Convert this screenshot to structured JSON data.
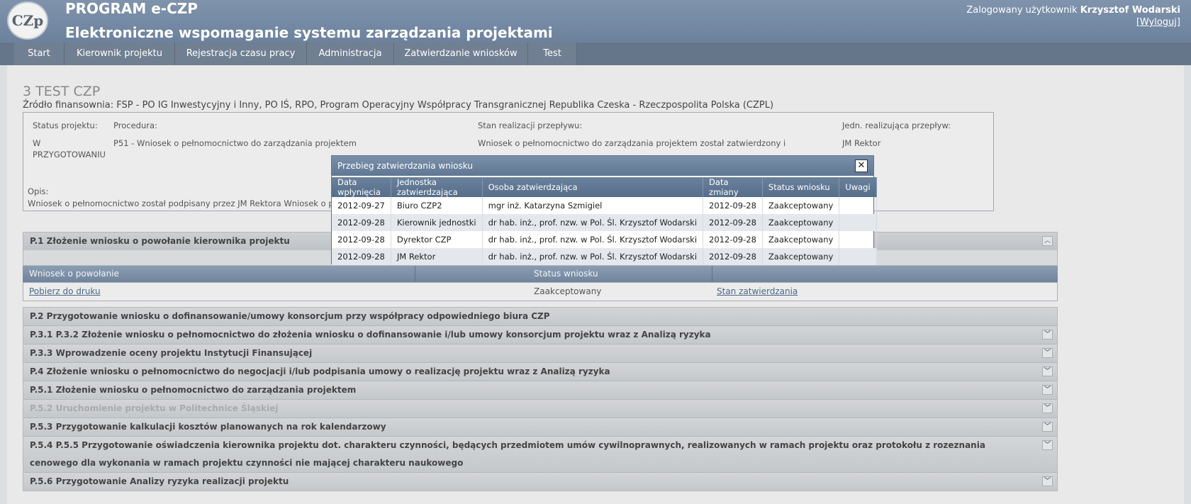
{
  "header": {
    "logo_text": "CZp",
    "app_title": "PROGRAM e-CZP",
    "app_subtitle": "Elektroniczne wspomaganie systemu zarządzania projektami",
    "user_label": "Zalogowany użytkownik",
    "user_name": "Krzysztof Wodarski",
    "logout_label": "Wyloguj"
  },
  "nav": {
    "items": [
      {
        "label": "Start"
      },
      {
        "label": "Kierownik projektu"
      },
      {
        "label": "Rejestracja czasu pracy"
      },
      {
        "label": "Administracja"
      },
      {
        "label": "Zatwierdzanie wniosków"
      },
      {
        "label": "Test"
      }
    ]
  },
  "project": {
    "title": "3 TEST CZP",
    "funding": "Źródło finansownia: FSP - PO IG Inwestycyjny i Inny, PO IŚ, RPO, Program Operacyjny Współpracy Transgranicznej Republika Czeska - Rzeczpospolita Polska (CZPL)",
    "status_label": "Status projektu:",
    "status_value": "W PRZYGOTOWANIU",
    "procedure_label": "Procedura:",
    "procedure_value": "P51 - Wniosek o pełnomocnictwo do zarządzania projektem",
    "flow_label": "Stan realizacji przepływu:",
    "flow_value": "Wniosek o pełnomocnictwo do zarządzania projektem został zatwierdzony i podpisany przez JM Rektora",
    "unit_label": "Jedn. realizująca przepływ:",
    "unit_value": "JM Rektor",
    "desc_label": "Opis:",
    "desc_value": "Wniosek o pełnomocnictwo został podpisany przez JM Rektora Wniosek o pełno"
  },
  "p1": {
    "header": "P.1 Złożenie wniosku o powołanie kierownika projektu",
    "col1": "Wniosek o powołanie",
    "col2": "Status wniosku",
    "row_link": "Pobierz do druku",
    "row_status": "Zaakceptowany",
    "row_action": "Stan zatwierdzania"
  },
  "accordion": [
    {
      "label": "P.2 Przygotowanie wniosku o dofinansowanie/umowy konsorcjum przy współpracy odpowiedniego biura CZP",
      "chevron": false,
      "disabled": false
    },
    {
      "label": "P.3.1 P.3.2 Złożenie wniosku o pełnomocnictwo do złożenia wniosku o dofinansowanie i/lub umowy konsorcjum projektu wraz z Analizą ryzyka",
      "chevron": true,
      "disabled": false
    },
    {
      "label": "P.3.3 Wprowadzenie oceny projektu Instytucji Finansującej",
      "chevron": true,
      "disabled": false
    },
    {
      "label": "P.4 Złożenie wniosku o pełnomocnictwo do negocjacji i/lub podpisania umowy o realizację projektu wraz z Analizą ryzyka",
      "chevron": true,
      "disabled": false
    },
    {
      "label": "P.5.1 Złożenie wniosku o pełnomocnictwo do zarządzania projektem",
      "chevron": true,
      "disabled": false
    },
    {
      "label": "P.5.2 Uruchomienie projektu w Politechnice Śląskiej",
      "chevron": true,
      "disabled": true
    },
    {
      "label": "P.5.3 Przygotowanie kalkulacji kosztów planowanych na rok kalendarzowy",
      "chevron": true,
      "disabled": false
    },
    {
      "label": "P.5.4 P.5.5 Przygotowanie oświadczenia kierownika projektu dot. charakteru czynności, będących przedmiotem umów cywilnoprawnych, realizowanych w ramach projektu oraz protokołu z rozeznania cenowego dla wykonania w ramach projektu czynności nie mającej charakteru naukowego",
      "chevron": true,
      "disabled": false
    },
    {
      "label": "P.5.6 Przygotowanie Analizy ryzyka realizacji projektu",
      "chevron": true,
      "disabled": false
    }
  ],
  "icons": {
    "chevron_up": "chevron-up-icon",
    "chevron_down": "chevron-down-icon",
    "close": "close-icon"
  },
  "modal": {
    "title": "Przebieg zatwierdzania wniosku",
    "close_glyph": "✕",
    "columns": [
      "Data wpłynięcia",
      "Jednostka zatwierdzająca",
      "Osoba zatwierdzająca",
      "Data zmiany",
      "Status wniosku",
      "Uwagi"
    ],
    "rows": [
      [
        "2012-09-27",
        "Biuro CZP2",
        "mgr inż. Katarzyna Szmigiel",
        "2012-09-28",
        "Zaakceptowany",
        ""
      ],
      [
        "2012-09-28",
        "Kierownik jednostki",
        "dr hab. inż., prof. nzw. w Pol. Śl. Krzysztof Wodarski",
        "2012-09-28",
        "Zaakceptowany",
        ""
      ],
      [
        "2012-09-28",
        "Dyrektor CZP",
        "dr hab. inż., prof. nzw. w Pol. Śl. Krzysztof Wodarski",
        "2012-09-28",
        "Zaakceptowany",
        ""
      ],
      [
        "2012-09-28",
        "JM Rektor",
        "dr hab. inż., prof. nzw. w Pol. Śl. Krzysztof Wodarski",
        "2012-09-28",
        "Zaakceptowany",
        ""
      ]
    ]
  }
}
